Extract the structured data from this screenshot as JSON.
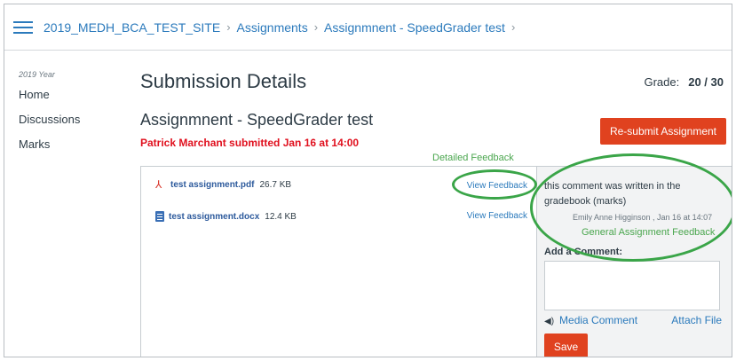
{
  "breadcrumb": [
    "2019_MEDH_BCA_TEST_SITE",
    "Assignments",
    "Assignmnent - SpeedGrader test"
  ],
  "sidebar": {
    "term": "2019 Year",
    "items": [
      {
        "label": "Home"
      },
      {
        "label": "Discussions"
      },
      {
        "label": "Marks"
      }
    ]
  },
  "main": {
    "page_title": "Submission Details",
    "grade_label": "Grade:",
    "grade_value": "20 / 30",
    "assignment_title": "Assignmnent - SpeedGrader test",
    "submitted_text": "Patrick Marchant submitted Jan 16 at 14:00",
    "resubmit_label": "Re-submit Assignment",
    "detailed_feedback_label": "Detailed Feedback"
  },
  "files": [
    {
      "name": "test assignment.pdf",
      "size": "26.7 KB",
      "icon": "pdf-icon",
      "action": "View Feedback"
    },
    {
      "name": "test assignment.docx",
      "size": "12.4 KB",
      "icon": "doc-icon",
      "action": "View Feedback"
    }
  ],
  "comments": {
    "text": "this comment was written in the gradebook (marks)",
    "author_meta": "Emily Anne Higginson , Jan 16 at 14:07",
    "general_feedback_label": "General Assignment Feedback",
    "add_comment_label": "Add a Comment:",
    "comment_value": "",
    "media_comment_label": "Media Comment",
    "attach_file_label": "Attach File",
    "save_label": "Save"
  },
  "colors": {
    "link": "#2b7abc",
    "accent_button": "#e0421f",
    "annotation": "#3aa548",
    "submitted": "#e0101e"
  }
}
